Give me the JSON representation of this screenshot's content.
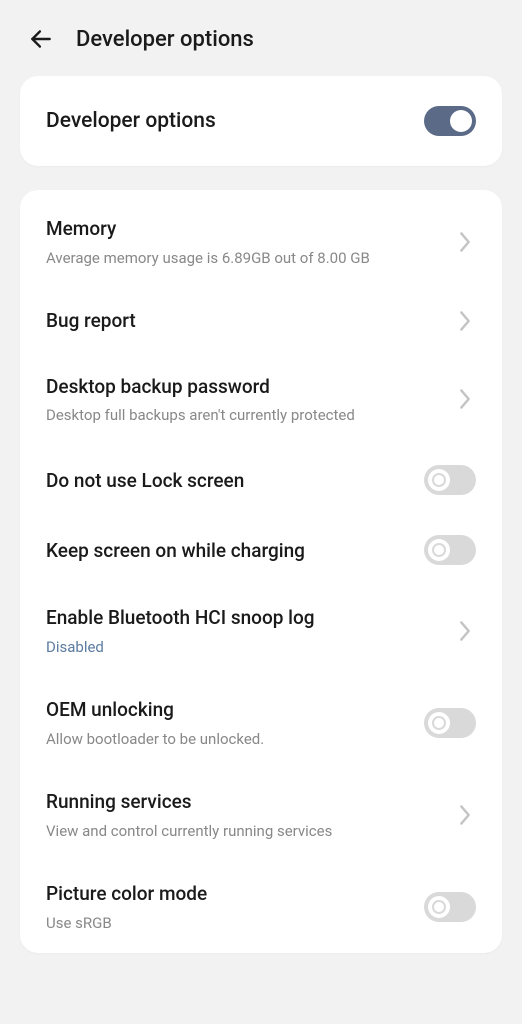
{
  "header": {
    "title": "Developer options"
  },
  "master": {
    "title": "Developer options",
    "enabled": true
  },
  "settings": [
    {
      "title": "Memory",
      "subtitle": "Average memory usage is 6.89GB out of 8.00 GB",
      "type": "nav"
    },
    {
      "title": "Bug report",
      "type": "nav"
    },
    {
      "title": "Desktop backup password",
      "subtitle": "Desktop full backups aren't currently protected",
      "type": "nav"
    },
    {
      "title": "Do not use Lock screen",
      "type": "toggle",
      "enabled": false
    },
    {
      "title": "Keep screen on while charging",
      "type": "toggle",
      "enabled": false
    },
    {
      "title": "Enable Bluetooth HCI snoop log",
      "subtitle": "Disabled",
      "subtitleLink": true,
      "type": "nav"
    },
    {
      "title": "OEM unlocking",
      "subtitle": "Allow bootloader to be unlocked.",
      "type": "toggle",
      "enabled": false
    },
    {
      "title": "Running services",
      "subtitle": "View and control currently running services",
      "type": "nav"
    },
    {
      "title": "Picture color mode",
      "subtitle": "Use sRGB",
      "type": "toggle",
      "enabled": false
    }
  ]
}
